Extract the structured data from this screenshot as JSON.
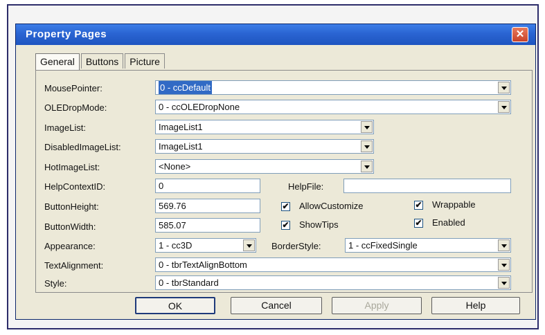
{
  "window": {
    "title": "Property Pages",
    "close_glyph": "✕"
  },
  "tabs": [
    {
      "label": "General",
      "active": true
    },
    {
      "label": "Buttons",
      "active": false
    },
    {
      "label": "Picture",
      "active": false
    }
  ],
  "fields": {
    "mouse_pointer": {
      "label": "MousePointer:",
      "value": "0 - ccDefault"
    },
    "ole_drop_mode": {
      "label": "OLEDropMode:",
      "value": "0 - ccOLEDropNone"
    },
    "image_list": {
      "label": "ImageList:",
      "value": "ImageList1"
    },
    "disabled_image_list": {
      "label": "DisabledImageList:",
      "value": "ImageList1"
    },
    "hot_image_list": {
      "label": "HotImageList:",
      "value": "<None>"
    },
    "help_context_id": {
      "label": "HelpContextID:",
      "value": "0"
    },
    "help_file": {
      "label": "HelpFile:",
      "value": ""
    },
    "button_height": {
      "label": "ButtonHeight:",
      "value": "569.76"
    },
    "button_width": {
      "label": "ButtonWidth:",
      "value": "585.07"
    },
    "appearance": {
      "label": "Appearance:",
      "value": "1 - cc3D"
    },
    "border_style": {
      "label": "BorderStyle:",
      "value": "1 - ccFixedSingle"
    },
    "text_alignment": {
      "label": "TextAlignment:",
      "value": "0 - tbrTextAlignBottom"
    },
    "style": {
      "label": "Style:",
      "value": "0 - tbrStandard"
    }
  },
  "checkboxes": {
    "allow_customize": {
      "label": "AllowCustomize",
      "checked": true
    },
    "wrappable": {
      "label": "Wrappable",
      "checked": true
    },
    "show_tips": {
      "label": "ShowTips",
      "checked": true
    },
    "enabled": {
      "label": "Enabled",
      "checked": true
    }
  },
  "check_glyph": "✔",
  "buttons": {
    "ok": "OK",
    "cancel": "Cancel",
    "apply": "Apply",
    "help": "Help"
  }
}
